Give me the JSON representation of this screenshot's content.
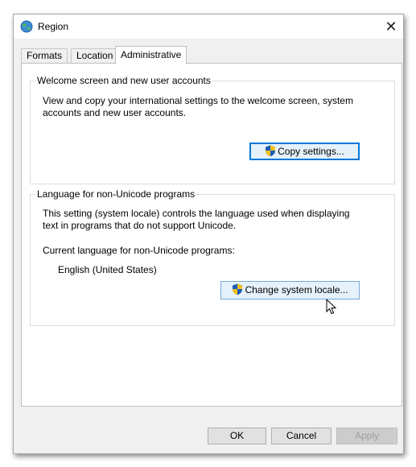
{
  "window": {
    "title": "Region",
    "close_glyph": "✕"
  },
  "tabs": [
    {
      "label": "Formats"
    },
    {
      "label": "Location"
    },
    {
      "label": "Administrative",
      "active": true
    }
  ],
  "welcome_group": {
    "title": "Welcome screen and new user accounts",
    "description_line1": "View and copy your international settings to the welcome screen, system",
    "description_line2": "accounts and new user accounts.",
    "button_label": "Copy settings..."
  },
  "nonunicode_group": {
    "title": "Language for non-Unicode programs",
    "description_line1": "This setting (system locale) controls the language used when displaying",
    "description_line2": "text in programs that do not support Unicode.",
    "current_label": "Current language for non-Unicode programs:",
    "current_value": "English (United States)",
    "button_label": "Change system locale..."
  },
  "footer": {
    "ok_label": "OK",
    "cancel_label": "Cancel",
    "apply_label": "Apply"
  },
  "icons": {
    "title": "globe-icon",
    "admin": "uac-shield-icon",
    "pointer": "mouse-pointer-icon"
  },
  "colors": {
    "focus_border": "#0078d7",
    "group_border": "#d5dfe5",
    "window_bg": "#f0f0f0"
  }
}
